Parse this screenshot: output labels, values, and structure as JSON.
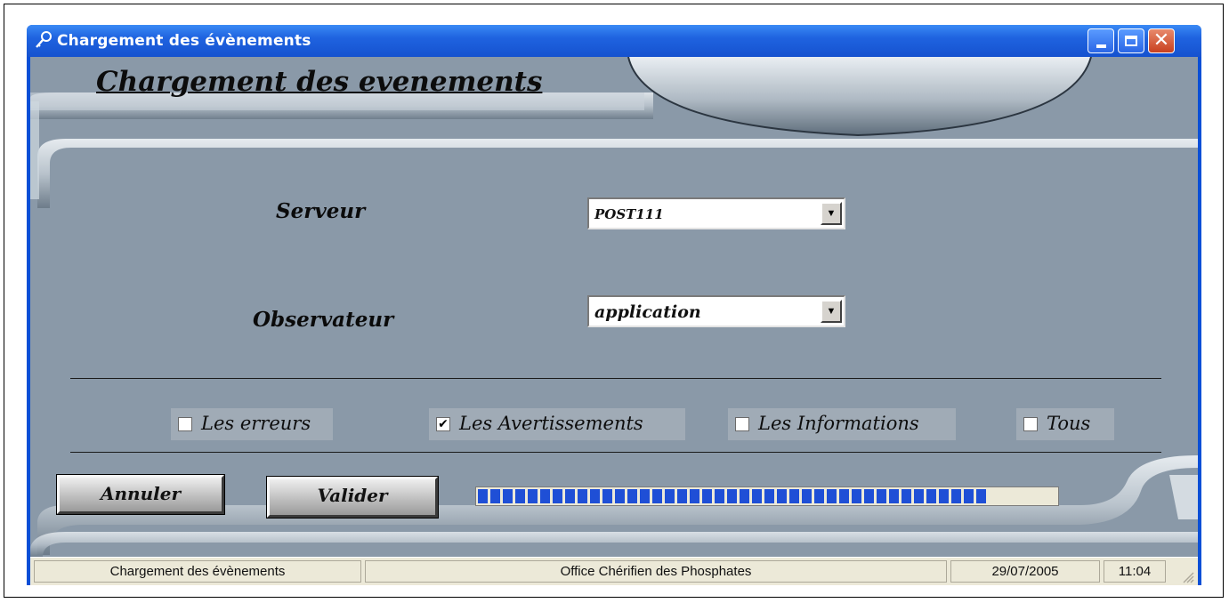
{
  "window": {
    "title": "Chargement des évènements",
    "icon": "key-icon"
  },
  "form": {
    "heading": "Chargement des evenements",
    "server_label": "Serveur",
    "server_value": "POST111",
    "observer_label": "Observateur",
    "observer_value": "application"
  },
  "checkboxes": [
    {
      "label": "Les erreurs",
      "checked": false
    },
    {
      "label": "Les Avertissements",
      "checked": true
    },
    {
      "label": "Les Informations",
      "checked": false
    },
    {
      "label": "Tous",
      "checked": false
    }
  ],
  "buttons": {
    "cancel": "Annuler",
    "validate": "Valider"
  },
  "progress": {
    "fraction": 0.88,
    "color": "#1f4fd6"
  },
  "statusbar": {
    "module": "Chargement des évènements",
    "company": "Office Chérifien des Phosphates",
    "date": "29/07/2005",
    "time": "11:04"
  }
}
